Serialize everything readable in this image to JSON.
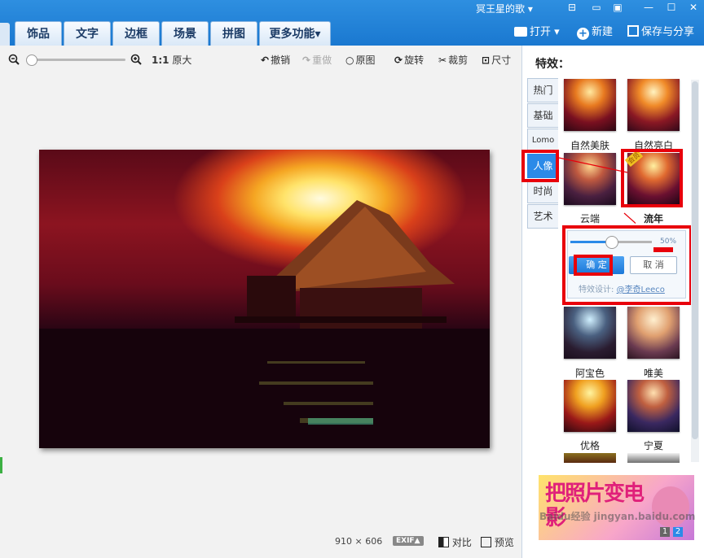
{
  "window": {
    "username": "冥王星的歌",
    "buttons": [
      "▾",
      "⊟",
      "▭",
      "▣",
      "—",
      "☐",
      "✕"
    ]
  },
  "tabs": [
    "饰品",
    "文字",
    "边框",
    "场景",
    "拼图",
    "更多功能▾"
  ],
  "top_actions": {
    "open": "打开",
    "open_arrow": "▾",
    "new": "新建",
    "save_share": "保存与分享"
  },
  "toolbar": {
    "zoom_label_ratio": "1:1",
    "zoom_label_text": "原大",
    "undo": "撤销",
    "redo": "重做",
    "original": "原图",
    "rotate": "旋转",
    "crop": "裁剪",
    "size": "尺寸"
  },
  "status": {
    "width": "910",
    "times": "×",
    "height": "606",
    "exif": "EXIF▲",
    "compare": "对比",
    "preview": "预览"
  },
  "panel": {
    "title": "特效：",
    "categories": [
      "热门",
      "基础",
      "Lomo",
      "人像",
      "时尚",
      "艺术"
    ],
    "effects": [
      "自然美肤",
      "自然亮白",
      "云端",
      "流年",
      "阿宝色",
      "唯美",
      "优格",
      "宁夏"
    ],
    "badge": "会员",
    "slider_value": "50%",
    "slider_level": 0.5,
    "confirm": "确 定",
    "cancel": "取 消",
    "designer_label": "特效设计:",
    "designer_name": "@李奇Leeco",
    "ad_text": "把照片变电影",
    "ad_pages": [
      "1",
      "2"
    ],
    "watermark": "Baidu经验 jingyan.baidu.com"
  },
  "colors": {
    "accent": "#1a78d0",
    "highlight": "#e8000b",
    "confirm": "#2b8ae8"
  }
}
